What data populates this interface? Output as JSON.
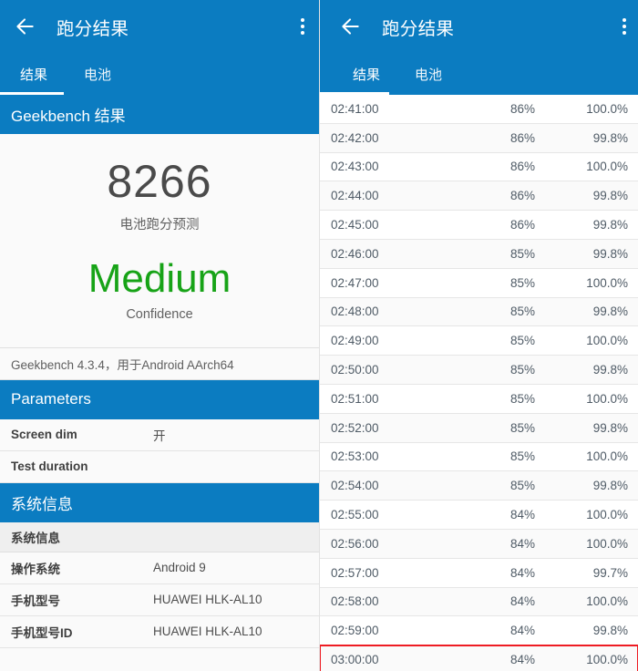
{
  "left_panel": {
    "appbar": {
      "back_icon": "arrow-left-icon",
      "title": "跑分结果",
      "overflow_icon": "more-vertical-icon"
    },
    "tabs": [
      {
        "label": "结果",
        "selected": true
      },
      {
        "label": "电池",
        "selected": false
      }
    ],
    "results_section": {
      "header": "Geekbench 结果",
      "score": "8266",
      "score_caption": "电池跑分预测",
      "confidence": "Medium",
      "confidence_caption": "Confidence",
      "confidence_color": "#17a317",
      "version_line": "Geekbench 4.3.4，用于Android AArch64"
    },
    "parameters_section": {
      "header": "Parameters",
      "rows": [
        {
          "key": "Screen dim",
          "value": "开"
        },
        {
          "key": "Test duration",
          "value": ""
        }
      ]
    },
    "system_section": {
      "header": "系统信息",
      "subheader": "系统信息",
      "rows": [
        {
          "key": "操作系统",
          "value": "Android 9"
        },
        {
          "key": "手机型号",
          "value": "HUAWEI HLK-AL10"
        },
        {
          "key": "手机型号ID",
          "value": "HUAWEI HLK-AL10"
        }
      ]
    }
  },
  "right_panel": {
    "appbar": {
      "back_icon": "arrow-left-icon",
      "title": "跑分结果",
      "overflow_icon": "more-vertical-icon"
    },
    "tabs": [
      {
        "label": "结果",
        "selected": true
      },
      {
        "label": "电池",
        "selected": false
      }
    ],
    "battery_table": {
      "rows": [
        {
          "time": "02:41:00",
          "charge": "86%",
          "relative": "100.0%",
          "highlighted": false
        },
        {
          "time": "02:42:00",
          "charge": "86%",
          "relative": "99.8%",
          "highlighted": false
        },
        {
          "time": "02:43:00",
          "charge": "86%",
          "relative": "100.0%",
          "highlighted": false
        },
        {
          "time": "02:44:00",
          "charge": "86%",
          "relative": "99.8%",
          "highlighted": false
        },
        {
          "time": "02:45:00",
          "charge": "86%",
          "relative": "99.8%",
          "highlighted": false
        },
        {
          "time": "02:46:00",
          "charge": "85%",
          "relative": "99.8%",
          "highlighted": false
        },
        {
          "time": "02:47:00",
          "charge": "85%",
          "relative": "100.0%",
          "highlighted": false
        },
        {
          "time": "02:48:00",
          "charge": "85%",
          "relative": "99.8%",
          "highlighted": false
        },
        {
          "time": "02:49:00",
          "charge": "85%",
          "relative": "100.0%",
          "highlighted": false
        },
        {
          "time": "02:50:00",
          "charge": "85%",
          "relative": "99.8%",
          "highlighted": false
        },
        {
          "time": "02:51:00",
          "charge": "85%",
          "relative": "100.0%",
          "highlighted": false
        },
        {
          "time": "02:52:00",
          "charge": "85%",
          "relative": "99.8%",
          "highlighted": false
        },
        {
          "time": "02:53:00",
          "charge": "85%",
          "relative": "100.0%",
          "highlighted": false
        },
        {
          "time": "02:54:00",
          "charge": "85%",
          "relative": "99.8%",
          "highlighted": false
        },
        {
          "time": "02:55:00",
          "charge": "84%",
          "relative": "100.0%",
          "highlighted": false
        },
        {
          "time": "02:56:00",
          "charge": "84%",
          "relative": "100.0%",
          "highlighted": false
        },
        {
          "time": "02:57:00",
          "charge": "84%",
          "relative": "99.7%",
          "highlighted": false
        },
        {
          "time": "02:58:00",
          "charge": "84%",
          "relative": "100.0%",
          "highlighted": false
        },
        {
          "time": "02:59:00",
          "charge": "84%",
          "relative": "99.8%",
          "highlighted": false
        },
        {
          "time": "03:00:00",
          "charge": "84%",
          "relative": "100.0%",
          "highlighted": true
        }
      ]
    }
  },
  "theme": {
    "primary": "#0b7cc1",
    "highlight_outline": "#ee1c23",
    "confidence_green": "#17a317"
  }
}
